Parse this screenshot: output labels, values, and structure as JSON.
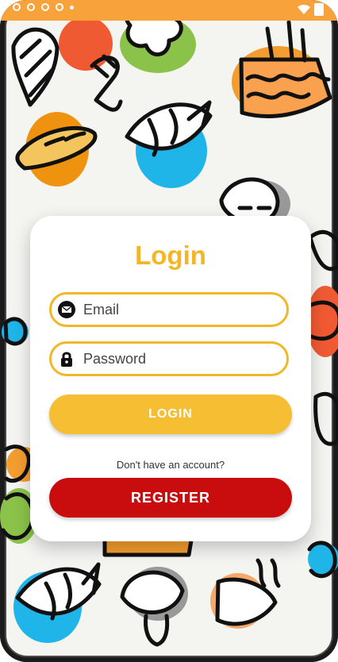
{
  "title": "Login",
  "fields": {
    "email_placeholder": "Email",
    "password_placeholder": "Password"
  },
  "buttons": {
    "login_label": "LOGIN",
    "register_label": "REGISTER"
  },
  "helper_text": "Don't have an account?",
  "icons": {
    "email": "email-icon",
    "password": "lock-icon"
  },
  "colors": {
    "accent_yellow": "#f5b528",
    "register_red": "#c90d0f",
    "status_orange": "#f7a23a"
  }
}
